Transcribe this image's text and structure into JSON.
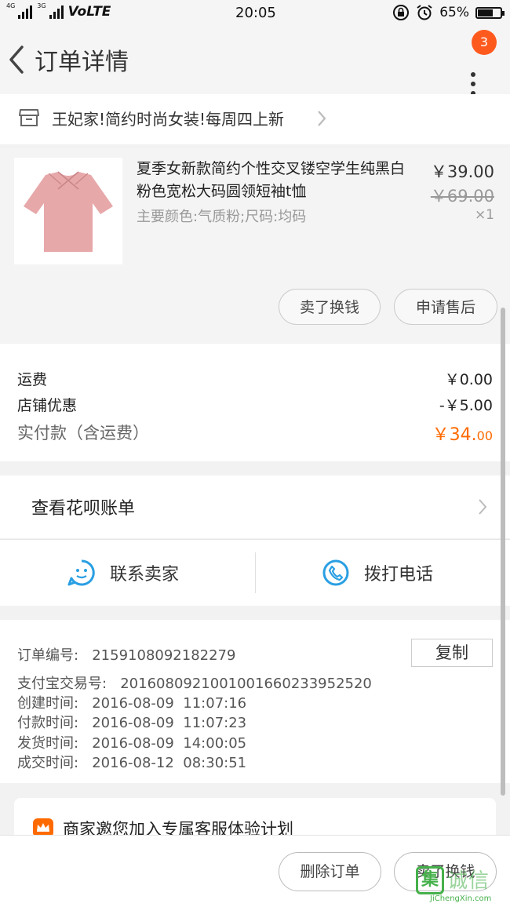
{
  "status_bar": {
    "network_1": "4G",
    "network_2": "3G",
    "carrier": "VoLTE",
    "time": "20:05",
    "battery": "65%"
  },
  "nav": {
    "title": "订单详情",
    "badge_count": "3"
  },
  "shop": {
    "name": "王妃家!简约时尚女装!每周四上新"
  },
  "product": {
    "title": "夏季女新款简约个性交叉镂空学生纯黑白粉色宽松大码圆领短袖t恤",
    "spec": "主要颜色:气质粉;尺码:均码",
    "price": "￥39.00",
    "original_price": "￥69.00",
    "quantity": "×1",
    "btn_sell": "卖了换钱",
    "btn_aftersale": "申请售后"
  },
  "summary": {
    "shipping_label": "运费",
    "shipping_value": "￥0.00",
    "discount_label": "店铺优惠",
    "discount_value": "-￥5.00",
    "total_label": "实付款（含运费）",
    "total_main": "￥34.",
    "total_cents": "00"
  },
  "huabei": {
    "label": "查看花呗账单"
  },
  "contact": {
    "seller": "联系卖家",
    "phone": "拨打电话"
  },
  "order_info": {
    "order_no": "订单编号:   2159108092182279",
    "alipay_no": "支付宝交易号:   2016080921001001660233952520",
    "created": "创建时间:   2016-08-09  11:07:16",
    "paid": "付款时间:   2016-08-09  11:07:23",
    "shipped": "发货时间:   2016-08-09  14:00:05",
    "completed": "成交时间:   2016-08-12  08:30:51",
    "copy_label": "复制"
  },
  "invite": {
    "text": "商家邀您加入专属客服体验计划"
  },
  "bottom": {
    "delete_label": "删除订单",
    "sell_label": "卖了换钱"
  },
  "watermark": {
    "box": "集",
    "cn": "诚信",
    "en": "JiChengXin.com"
  },
  "colors": {
    "accent": "#ff6a00",
    "badge": "#ff5a1e",
    "icon_blue": "#2a9fe3",
    "shop_icon": "#ff6a00"
  }
}
